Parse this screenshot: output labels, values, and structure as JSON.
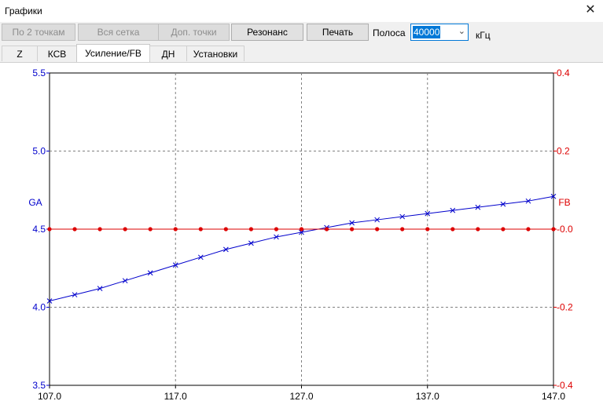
{
  "window": {
    "title": "Графики",
    "close_label": "✕"
  },
  "toolbar": {
    "btn_two_points": "По 2 точкам",
    "btn_whole_grid": "Вся сетка",
    "btn_extra_points": "Доп. точки",
    "btn_resonance": "Резонанс",
    "btn_print": "Печать",
    "band_label": "Полоса",
    "band_value": "40000",
    "band_unit": "кГц"
  },
  "tabs": [
    "Z",
    "КСВ",
    "Усиление/FB",
    "ДН",
    "Установки"
  ],
  "active_tab": "Усиление/FB",
  "colors": {
    "ga": "#0000cc",
    "fb": "#dd0000",
    "grid": "#808080"
  },
  "chart_data": {
    "type": "line",
    "x_ticks": [
      "107.0",
      "117.0",
      "127.0",
      "137.0",
      "147.0"
    ],
    "xlim": [
      107,
      147
    ],
    "left_axis": {
      "label": "GA",
      "ticks": [
        "5.5",
        "5.0",
        "4.5",
        "4.0",
        "3.5"
      ],
      "ylim": [
        3.5,
        5.5
      ]
    },
    "right_axis": {
      "label": "FB",
      "ticks": [
        "0.4",
        "0.2",
        "-0.0",
        "-0.2",
        "-0.4"
      ],
      "ylim": [
        -0.4,
        0.4
      ]
    },
    "grid": true,
    "series": [
      {
        "name": "GA",
        "axis": "left",
        "marker": "x",
        "x": [
          107,
          109,
          111,
          113,
          115,
          117,
          119,
          121,
          123,
          125,
          127,
          129,
          131,
          133,
          135,
          137,
          139,
          141,
          143,
          145,
          147
        ],
        "y": [
          4.04,
          4.08,
          4.12,
          4.17,
          4.22,
          4.27,
          4.32,
          4.37,
          4.41,
          4.45,
          4.48,
          4.51,
          4.54,
          4.56,
          4.58,
          4.6,
          4.62,
          4.64,
          4.66,
          4.68,
          4.71
        ]
      },
      {
        "name": "FB",
        "axis": "right",
        "marker": "dot",
        "x": [
          107,
          109,
          111,
          113,
          115,
          117,
          119,
          121,
          123,
          125,
          127,
          129,
          131,
          133,
          135,
          137,
          139,
          141,
          143,
          145,
          147
        ],
        "y": [
          0,
          0,
          0,
          0,
          0,
          0,
          0,
          0,
          0,
          0,
          0,
          0,
          0,
          0,
          0,
          0,
          0,
          0,
          0,
          0,
          0
        ]
      }
    ]
  }
}
